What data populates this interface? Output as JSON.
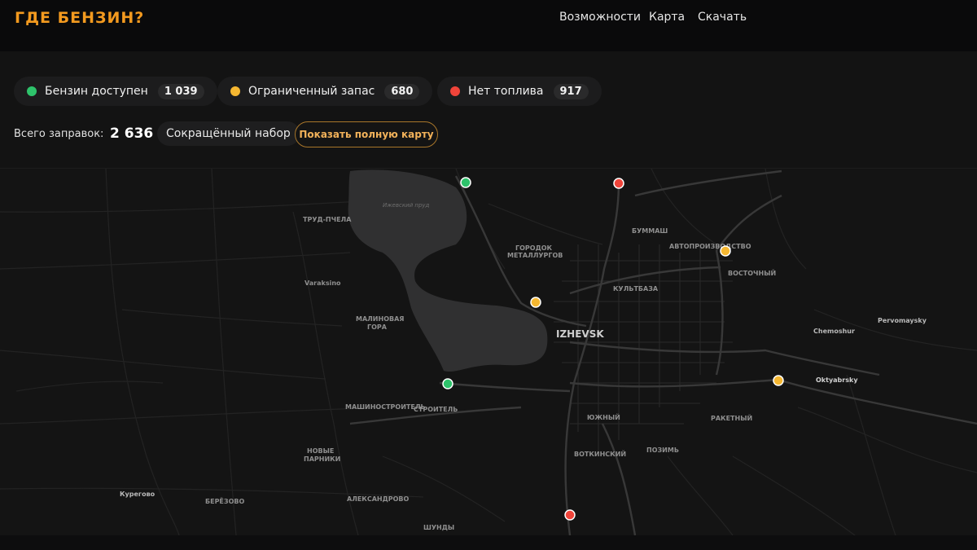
{
  "header": {
    "logo": "ГДЕ БЕНЗИН?",
    "nav": [
      {
        "label": "Возможности"
      },
      {
        "label": "Карта"
      },
      {
        "label": "Скачать"
      }
    ]
  },
  "legend": [
    {
      "label": "Бензин доступен",
      "count": "1 039",
      "color": "#2ec36b"
    },
    {
      "label": "Ограниченный запас",
      "count": "680",
      "color": "#f5b731"
    },
    {
      "label": "Нет топлива",
      "count": "917",
      "color": "#f0443a"
    }
  ],
  "summary": {
    "total_label": "Всего заправок:",
    "total_value": "2 636",
    "short_set_label": "Сокращённый набор",
    "full_map_label": "Показать полную карту"
  },
  "map": {
    "lake_label": "Ижевский пруд",
    "city_label": "IZHEVSK",
    "place_labels": [
      "ТРУД-ПЧЕЛА",
      "Varaksino",
      "МАЛИНОВАЯ",
      "ГОРА",
      "МАШИНОСТРОИТЕЛЬ",
      "СТРОИТЕЛЬ",
      "НОВЫЕ",
      "ПАРНИКИ",
      "Курегово",
      "БЕРЁЗОВО",
      "АЛЕКСАНДРОВО",
      "ШУНДЫ",
      "ГОРОДОК",
      "МЕТАЛЛУРГОВ",
      "БУММАШ",
      "АВТОПРОИЗВОДСТВО",
      "ВОСТОЧНЫЙ",
      "КУЛЬТБАЗА",
      "ЮЖНЫЙ",
      "ВОТКИНСКИЙ",
      "ПОЗИМЬ",
      "РАКЕТНЫЙ",
      "Chemoshur",
      "Pervomaysky",
      "Oktyabrsky"
    ],
    "markers": [
      {
        "status": "available",
        "color": "#2ec36b"
      },
      {
        "status": "none",
        "color": "#f0443a"
      },
      {
        "status": "limited",
        "color": "#f5b731"
      },
      {
        "status": "limited",
        "color": "#f5b731"
      },
      {
        "status": "available",
        "color": "#2ec36b"
      },
      {
        "status": "limited",
        "color": "#f5b731"
      },
      {
        "status": "none",
        "color": "#f0443a"
      }
    ]
  }
}
